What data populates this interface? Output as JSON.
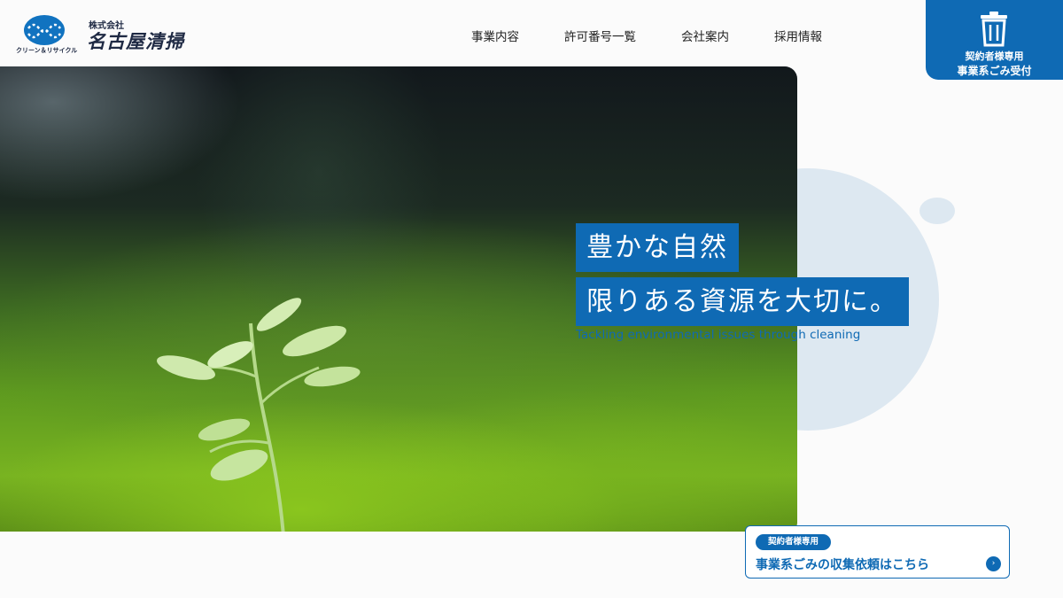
{
  "header": {
    "logo": {
      "tagline": "クリーン＆リサイクル",
      "company_type": "株式会社",
      "company_name": "名古屋清掃"
    },
    "nav": [
      {
        "label": "事業内容"
      },
      {
        "label": "許可番号一覧"
      },
      {
        "label": "会社案内"
      },
      {
        "label": "採用情報"
      }
    ],
    "contract_cta": {
      "line1": "契約者様専用",
      "line2": "事業系ごみ受付",
      "icon": "trash-icon"
    }
  },
  "hero": {
    "headline_line1": "豊かな自然",
    "headline_line2": "限りある資源を大切に。",
    "subtitle": "Tackling environmental issues through cleaning"
  },
  "bottom_cta": {
    "badge": "契約者様専用",
    "label": "事業系ごみの収集依頼はこちら",
    "arrow": "›",
    "icon": "chevron-right-icon"
  },
  "colors": {
    "brand_blue": "#0f6ab4",
    "navy": "#1f2a44",
    "bubble": "#dde8f1"
  }
}
